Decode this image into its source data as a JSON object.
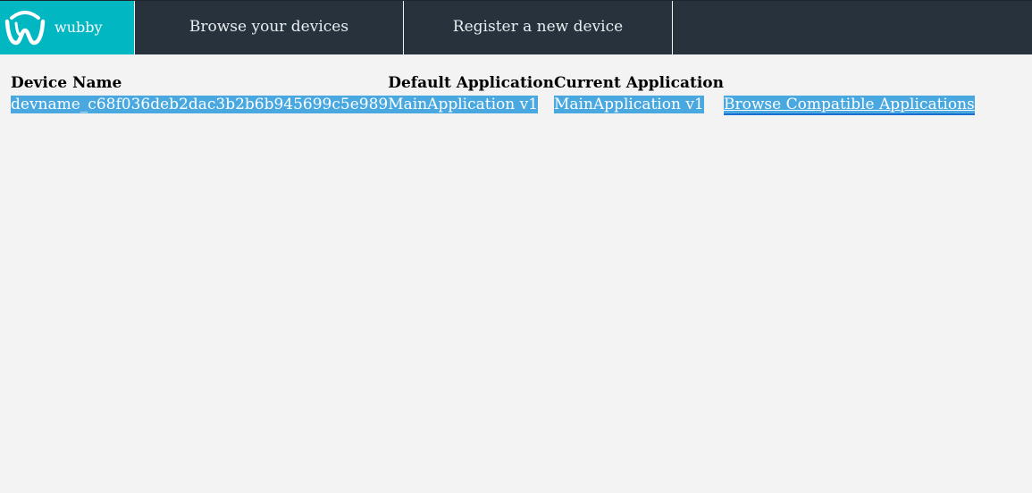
{
  "brand": {
    "name": "wubby",
    "accent_color": "#00b7c2",
    "icon": "wubby-logo-icon"
  },
  "nav": {
    "items": [
      {
        "label": "Browse your devices"
      },
      {
        "label": "Register a new device"
      }
    ],
    "background": "#27323c"
  },
  "table": {
    "headers": [
      "Device Name",
      "Default Application",
      "Current Application"
    ],
    "rows": [
      {
        "device_name": "devname_c68f036deb2dac3b2b6b945699c5e989",
        "default_application": "MainApplication v1",
        "current_application": "MainApplication v1",
        "action": "Browse Compatible Applications"
      }
    ],
    "selection_color": "#4aa8e1"
  }
}
